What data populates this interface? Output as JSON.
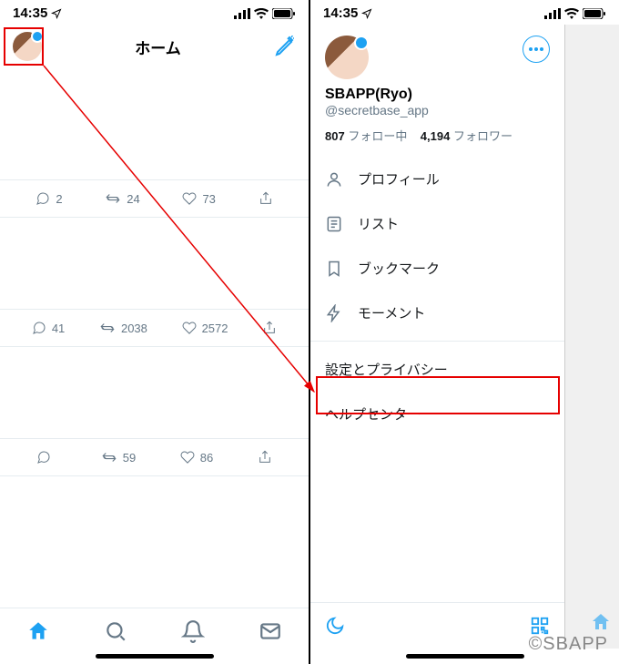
{
  "status": {
    "time": "14:35"
  },
  "left": {
    "title": "ホーム",
    "rows": [
      {
        "reply": "2",
        "retweet": "24",
        "like": "73"
      },
      {
        "reply": "41",
        "retweet": "2038",
        "like": "2572"
      },
      {
        "reply": "",
        "retweet": "59",
        "like": "86"
      }
    ]
  },
  "right": {
    "name": "SBAPP(Ryo)",
    "handle": "@secretbase_app",
    "following_count": "807",
    "following_label": "フォロー中",
    "followers_count": "4,194",
    "followers_label": "フォロワー",
    "menu": {
      "profile": "プロフィール",
      "lists": "リスト",
      "bookmarks": "ブックマーク",
      "moments": "モーメント",
      "settings": "設定とプライバシー",
      "help": "ヘルプセンター"
    }
  },
  "watermark": "©SBAPP"
}
